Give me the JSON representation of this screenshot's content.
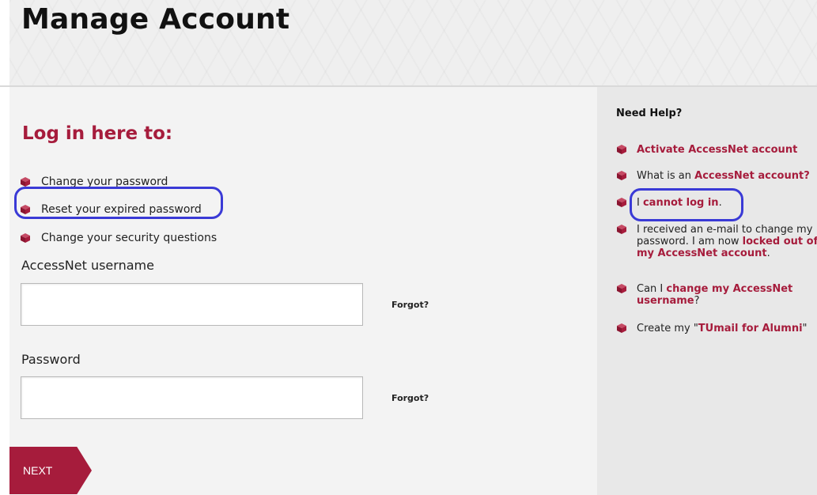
{
  "header": {
    "title": "Manage Account"
  },
  "login": {
    "heading": "Log in here to:",
    "bullets": [
      "Change your password",
      "Reset your expired password",
      "Change your security questions"
    ],
    "username_label": "AccessNet username",
    "username_value": "",
    "username_forgot": "Forgot?",
    "password_label": "Password",
    "password_value": "",
    "password_forgot": "Forgot?",
    "next_label": "NEXT"
  },
  "help": {
    "heading": "Need Help?",
    "items": [
      {
        "link": "Activate AccessNet account"
      },
      {
        "pre": "What is an ",
        "link": "AccessNet account?"
      },
      {
        "pre": "I ",
        "link": "cannot log in",
        "post": "."
      },
      {
        "line1": "I received an e-mail to change my",
        "line2_pre": "password. I am now ",
        "line2_link": "locked out of",
        "line3_link": "my AccessNet account",
        "line3_post": "."
      },
      {
        "pre": "Can I ",
        "link": "change my AccessNet",
        "line2_link": "username",
        "line2_post": "?"
      },
      {
        "pre": "Create my \"",
        "link": "TUmail for Alumni",
        "post": "\""
      }
    ]
  },
  "colors": {
    "brand": "#a61c3c",
    "annotation": "#3a3ad6"
  },
  "icons": {
    "bullet": "cube-icon"
  }
}
